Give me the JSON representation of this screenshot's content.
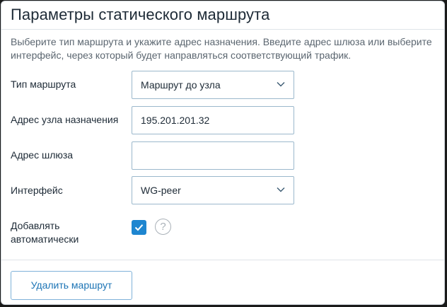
{
  "dialog": {
    "title": "Параметры статического маршрута",
    "description": "Выберите тип маршрута и укажите адрес назначения. Введите адрес шлюза или выберите интерфейс, через который будет направляться соответствующий трафик."
  },
  "form": {
    "route_type": {
      "label": "Тип маршрута",
      "value": "Маршрут до узла",
      "icon": "chevron-down-icon"
    },
    "destination": {
      "label": "Адрес узла назначения",
      "value": "195.201.201.32"
    },
    "gateway": {
      "label": "Адрес шлюза",
      "value": ""
    },
    "interface": {
      "label": "Интерфейс",
      "value": "WG-peer",
      "icon": "chevron-down-icon"
    },
    "auto_add": {
      "label": "Добавлять автоматически",
      "checked": true,
      "help_glyph": "?",
      "icon": "help-icon"
    }
  },
  "footer": {
    "delete_button": "Удалить маршрут"
  },
  "colors": {
    "accent": "#1e86d0",
    "field_border": "#9bb8cc",
    "button_text": "#1c74b5",
    "text": "#1d2a36",
    "muted_text": "#5b6670"
  }
}
